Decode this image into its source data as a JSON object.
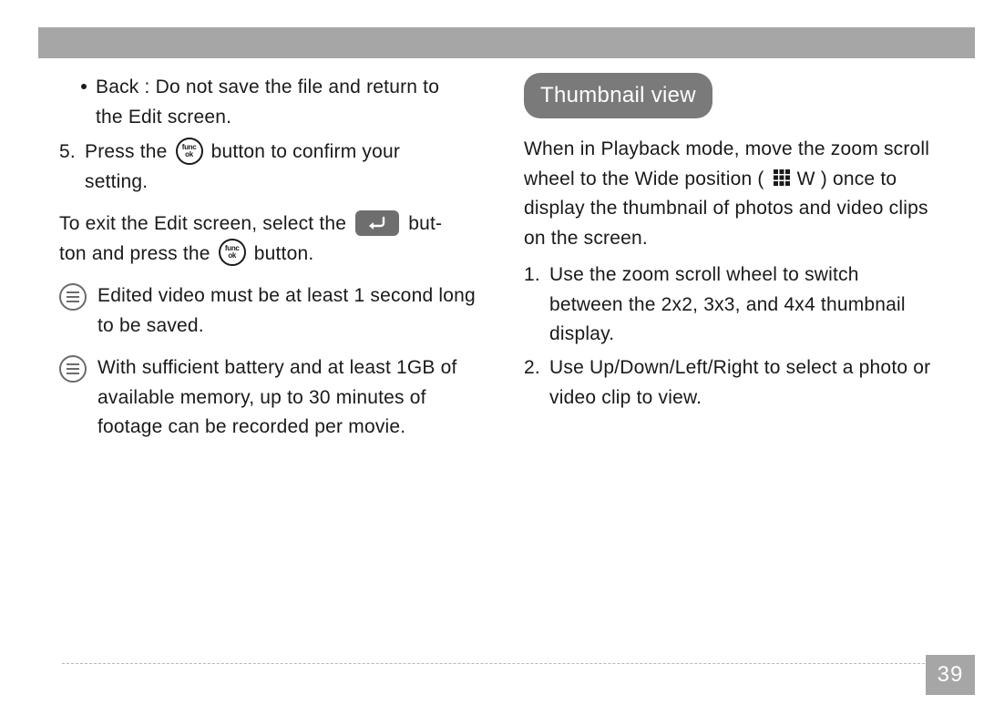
{
  "page_number": "39",
  "left": {
    "bullet_back_label": "Back",
    "bullet_back_sep": " : ",
    "bullet_back_rest_line1": "Do not save the file and return to",
    "bullet_back_rest_line2": "the Edit screen.",
    "step5_num": "5.",
    "step5_a": "Press the ",
    "step5_b": " button to confirm your",
    "step5_c": "setting.",
    "exit_a": "To exit the Edit screen, select the ",
    "exit_b": " but-",
    "exit_c": "ton and press the ",
    "exit_d": " button.",
    "note1": "Edited video must be at least 1 second long to be saved.",
    "note2": "With sufficient battery and at least 1GB of available memory, up to 30 minutes of footage can be recorded per movie."
  },
  "right": {
    "section_title": "Thumbnail view",
    "intro_a": "When in ",
    "intro_mode": "Playback   mode, move the zoom",
    "intro_b": " scroll wheel to the Wide position ( ",
    "intro_w": "W",
    "intro_c": " ) once to display the thumbnail of photos and video clips on the screen.",
    "step1_num": "1.",
    "step1_a": "Use the zoom scroll wheel to switch",
    "step1_b": "between the ",
    "step1_sizes": "2x2, 3x3",
    "step1_and": ", and ",
    "step1_last": "4x4",
    "step1_c": " thumbnail display.",
    "step2_num": "2.",
    "step2_a": "Use ",
    "step2_dirs": "Up/Down/Left/Right",
    "step2_b": "   to select a photo or video clip to view."
  },
  "icons": {
    "func_top": "func",
    "func_bot": "ok",
    "note_icon": "note-icon",
    "return_icon": "return-icon",
    "grid_icon": "thumbnail-grid-icon"
  }
}
